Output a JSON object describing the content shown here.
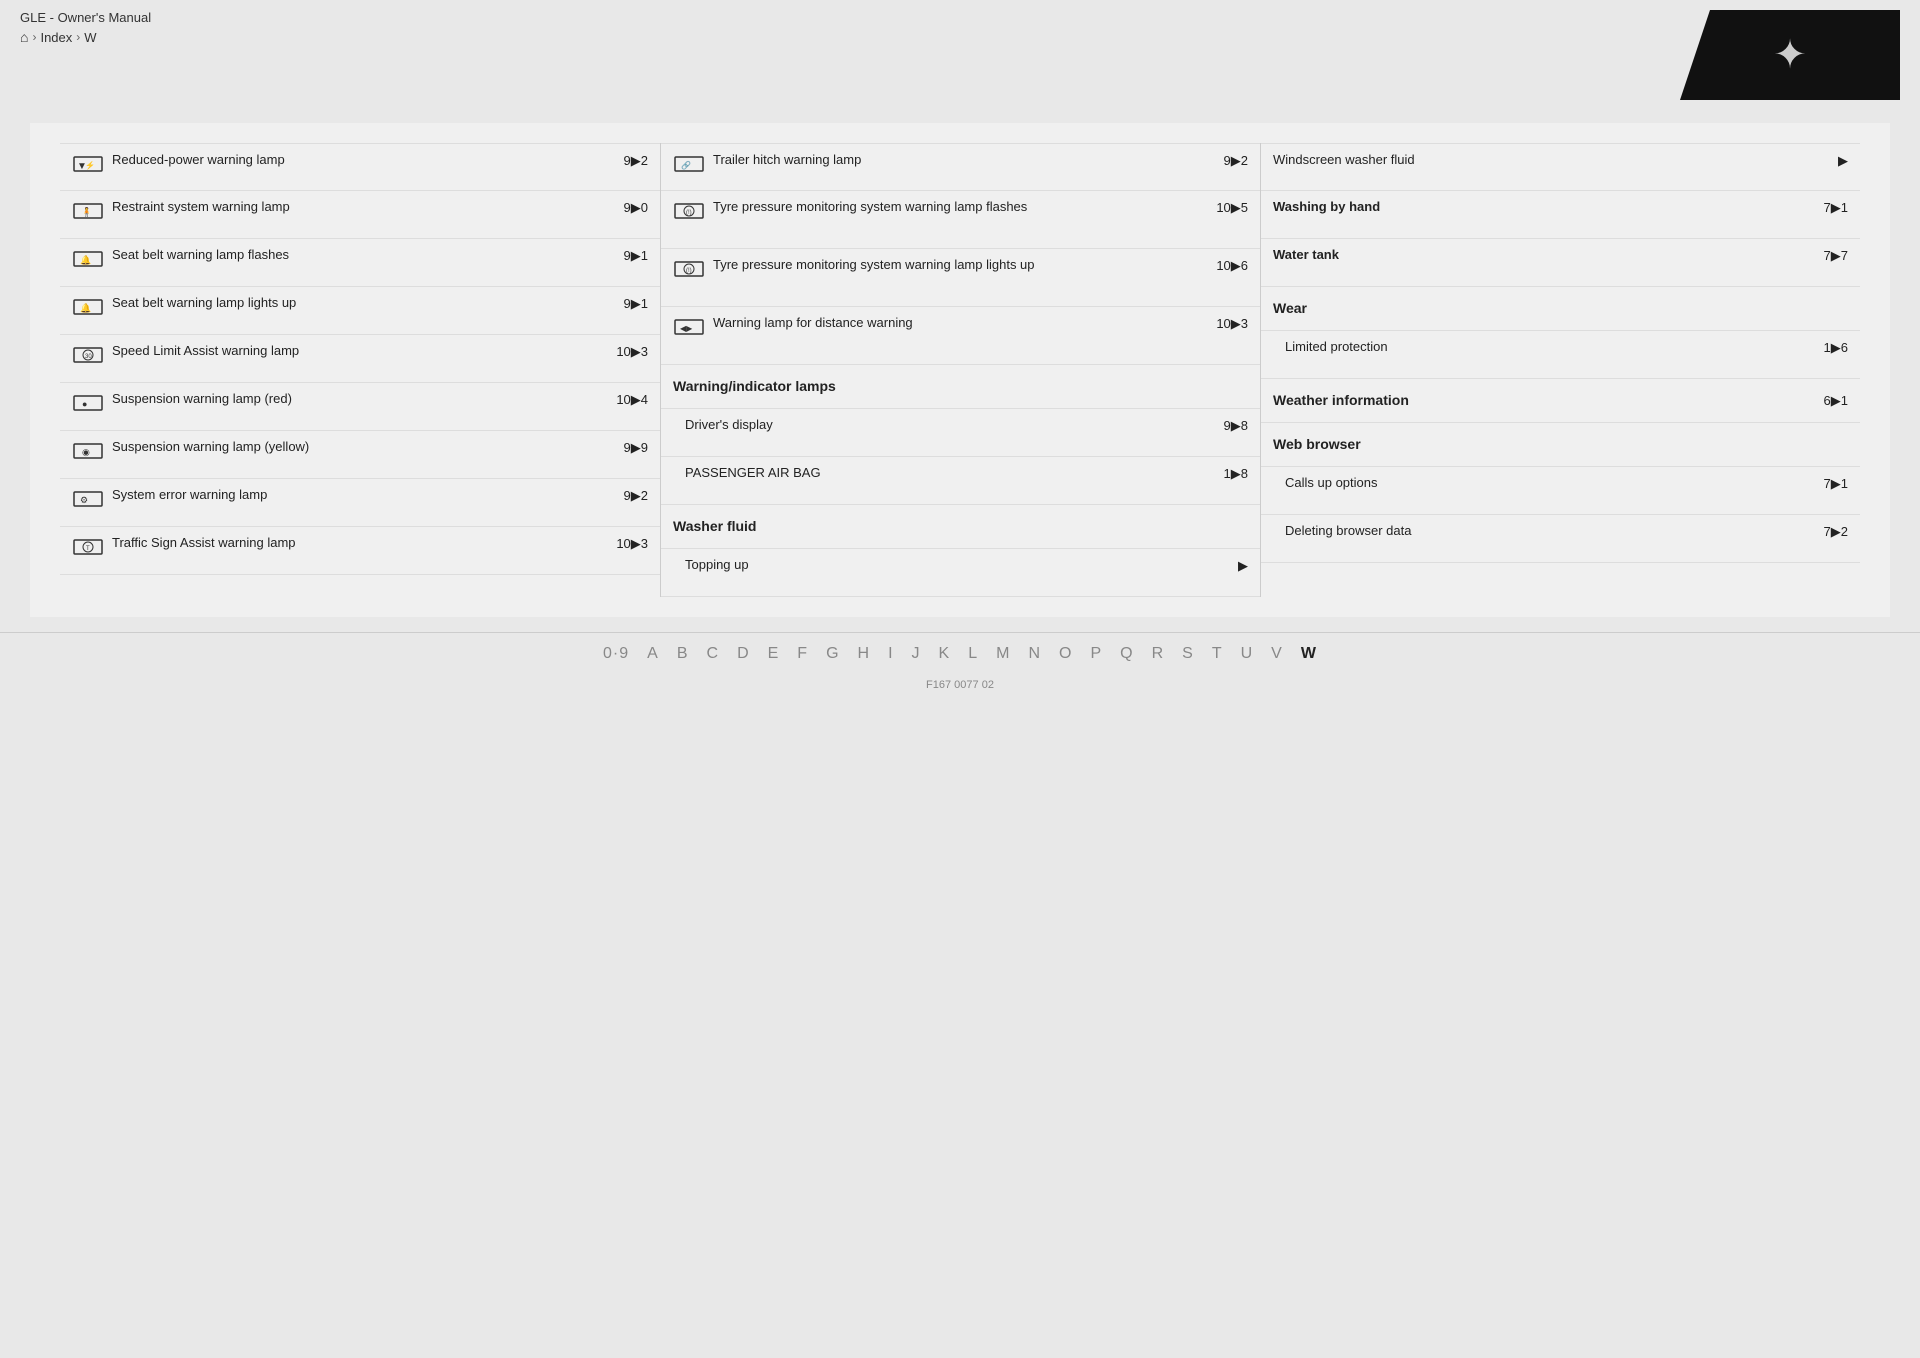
{
  "header": {
    "title": "GLE - Owner's Manual",
    "breadcrumb": {
      "home": "⌂",
      "items": [
        "Index",
        "W"
      ]
    }
  },
  "columns": [
    {
      "entries": [
        {
          "hasIcon": true,
          "iconType": "reduced-power",
          "text": "Reduced-power warning lamp",
          "page": "9▶2"
        },
        {
          "hasIcon": true,
          "iconType": "restraint",
          "text": "Restraint system warning lamp",
          "page": "9▶0"
        },
        {
          "hasIcon": true,
          "iconType": "seatbelt-flash",
          "text": "Seat belt warning lamp flashes",
          "page": "9▶1"
        },
        {
          "hasIcon": true,
          "iconType": "seatbelt-light",
          "text": "Seat belt warning lamp lights up",
          "page": "9▶1"
        },
        {
          "hasIcon": true,
          "iconType": "speed-limit",
          "text": "Speed Limit Assist warning lamp",
          "page": "10▶3"
        },
        {
          "hasIcon": true,
          "iconType": "suspension-red",
          "text": "Suspension warning lamp (red)",
          "page": "10▶4"
        },
        {
          "hasIcon": true,
          "iconType": "suspension-yel",
          "text": "Suspension warning lamp (yellow)",
          "page": "9▶9"
        },
        {
          "hasIcon": true,
          "iconType": "system-error",
          "text": "System error warning lamp",
          "page": "9▶2"
        },
        {
          "hasIcon": true,
          "iconType": "traffic-sign",
          "text": "Traffic Sign Assist warning lamp",
          "page": "10▶3"
        }
      ]
    },
    {
      "entries": [
        {
          "hasIcon": true,
          "iconType": "trailer",
          "text": "Trailer hitch warning lamp",
          "page": "9▶2"
        },
        {
          "hasIcon": true,
          "iconType": "tyre-flash",
          "text": "Tyre pressure monitoring system warning lamp flashes",
          "page": "10▶5"
        },
        {
          "hasIcon": true,
          "iconType": "tyre-light",
          "text": "Tyre pressure monitoring system warning lamp lights up",
          "page": "10▶6"
        },
        {
          "hasIcon": true,
          "iconType": "distance",
          "text": "Warning lamp for distance warning",
          "page": "10▶3"
        },
        {
          "isSectionHeader": true,
          "text": "Warning/indicator lamps"
        },
        {
          "isSubEntry": true,
          "text": "Driver's display",
          "page": "9▶8"
        },
        {
          "isSubEntry": true,
          "text": "PASSENGER AIR BAG",
          "page": "1▶8"
        },
        {
          "isSectionHeader": true,
          "text": "Washer fluid"
        },
        {
          "isSubEntry": true,
          "text": "Topping up",
          "page": "▶"
        }
      ]
    },
    {
      "entries": [
        {
          "text": "Windscreen washer fluid",
          "page": "▶",
          "hasIconRight": true
        },
        {
          "text": "Washing by hand",
          "page": "7▶1",
          "bold": true
        },
        {
          "text": "Water tank",
          "page": "7▶7",
          "bold": true
        },
        {
          "text": "Wear",
          "page": "",
          "bold": true,
          "isSectionHeader": true
        },
        {
          "isSubEntry": true,
          "text": "Limited protection",
          "page": "1▶6"
        },
        {
          "isSectionHeader": true,
          "text": "Weather information",
          "bold": true,
          "page": "6▶1"
        },
        {
          "isSectionHeader": true,
          "text": "Web browser",
          "bold": true
        },
        {
          "isSubEntry": true,
          "text": "Calls up options",
          "page": "7▶1"
        },
        {
          "isSubEntry": true,
          "text": "Deleting browser data",
          "page": "7▶2"
        }
      ]
    }
  ],
  "bottomNav": {
    "items": [
      "0·9",
      "A",
      "B",
      "C",
      "D",
      "E",
      "F",
      "G",
      "H",
      "I",
      "J",
      "K",
      "L",
      "M",
      "N",
      "O",
      "P",
      "Q",
      "R",
      "S",
      "T",
      "U",
      "V",
      "W"
    ],
    "active": "W",
    "footer": "F167 0077 02"
  }
}
